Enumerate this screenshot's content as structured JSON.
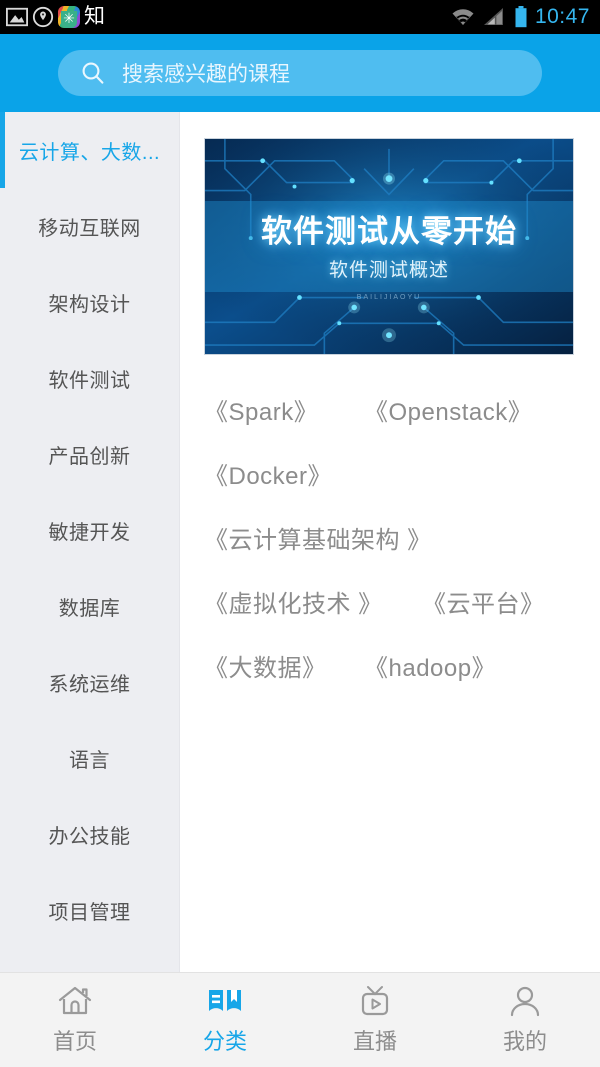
{
  "statusbar": {
    "icons": [
      "image-icon",
      "location-shield-icon",
      "app-badge-icon"
    ],
    "app_char": "知",
    "star_glyph": "✳",
    "wifi": "wifi-icon",
    "signal": "signal-icon",
    "battery": "battery-icon",
    "time": "10:47",
    "time_color": "#35b6ef"
  },
  "header": {
    "background": "#0aa3e8",
    "search": {
      "placeholder": "搜索感兴趣的课程",
      "icon": "search-icon",
      "background": "#4fbdf0"
    }
  },
  "sidebar": {
    "background": "#edeef2",
    "active_color": "#17a6e8",
    "active_index": 0,
    "items": [
      {
        "label": "云计算、大数..."
      },
      {
        "label": "移动互联网"
      },
      {
        "label": "架构设计"
      },
      {
        "label": "软件测试"
      },
      {
        "label": "产品创新"
      },
      {
        "label": "敏捷开发"
      },
      {
        "label": "数据库"
      },
      {
        "label": "系统运维"
      },
      {
        "label": "语言"
      },
      {
        "label": "办公技能"
      },
      {
        "label": "项目管理"
      }
    ]
  },
  "content": {
    "banner": {
      "title": "软件测试从零开始",
      "subtitle": "软件测试概述",
      "watermark": "BAILIJIAOYU",
      "theme_color": "#0a4f8a"
    },
    "tag_rows": [
      [
        {
          "text": "《Spark》"
        },
        {
          "text": "《Openstack》"
        }
      ],
      [
        {
          "text": "《Docker》"
        }
      ],
      [
        {
          "text": "《云计算基础架构 》"
        }
      ],
      [
        {
          "text": "《虚拟化技术 》"
        },
        {
          "text": "《云平台》"
        }
      ],
      [
        {
          "text": "《大数据》"
        },
        {
          "text": "《hadoop》"
        }
      ]
    ]
  },
  "tabbar": {
    "active_index": 1,
    "active_color": "#17a6e8",
    "inactive_color": "#8d8d8d",
    "tabs": [
      {
        "label": "首页",
        "icon": "home-icon"
      },
      {
        "label": "分类",
        "icon": "book-bookmark-icon"
      },
      {
        "label": "直播",
        "icon": "tv-play-icon"
      },
      {
        "label": "我的",
        "icon": "person-icon"
      }
    ]
  }
}
